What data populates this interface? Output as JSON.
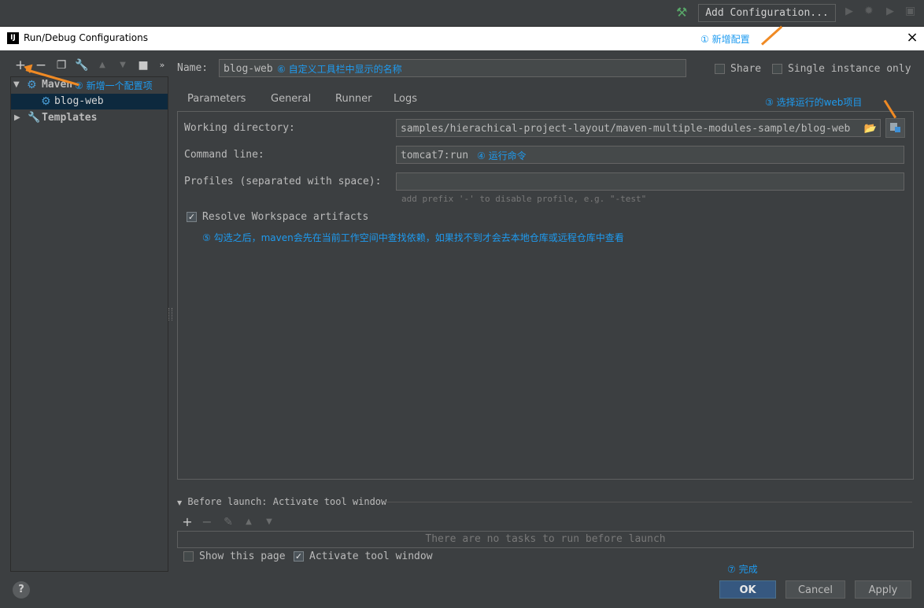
{
  "ide_toolbar": {
    "add_config_label": "Add Configuration..."
  },
  "dialog": {
    "title": "Run/Debug Configurations",
    "app_icon": "IJ",
    "close": "×",
    "help": "?"
  },
  "left_toolbar": {
    "icons": [
      "add-icon",
      "remove-icon",
      "copy-icon",
      "wrench-icon",
      "move-up-icon",
      "move-down-icon",
      "new-folder-icon",
      "more-icon"
    ]
  },
  "tree": {
    "maven_label": "Maven",
    "blog_web_label": "blog-web",
    "templates_label": "Templates"
  },
  "name_row": {
    "label": "Name:",
    "value": "blog-web",
    "share_label": "Share",
    "single_instance_label": "Single instance only"
  },
  "tabs": [
    "Parameters",
    "General",
    "Runner",
    "Logs"
  ],
  "params": {
    "working_dir_label": "Working directory:",
    "working_dir_value": "samples/hierachical-project-layout/maven-multiple-modules-sample/blog-web",
    "command_line_label": "Command line:",
    "command_line_value": "tomcat7:run",
    "profiles_label": "Profiles (separated with space):",
    "profiles_value": "",
    "profiles_hint": "add prefix '-' to disable profile, e.g. \"-test\"",
    "resolve_label": "Resolve Workspace artifacts",
    "resolve_checked": true
  },
  "before_launch": {
    "header": "Before launch: Activate tool window",
    "empty_text": "There are no tasks to run before launch",
    "show_page_label": "Show this page",
    "show_page_checked": false,
    "activate_label": "Activate tool window",
    "activate_checked": true
  },
  "buttons": {
    "ok": "OK",
    "cancel": "Cancel",
    "apply": "Apply"
  },
  "annotations": {
    "a1": "① 新增配置",
    "a2": "② 新增一个配置项",
    "a3": "③ 选择运行的web项目",
    "a4": "④ 运行命令",
    "a5": "⑤ 勾选之后，maven会先在当前工作空间中查找依赖，如果找不到才会去本地仓库或远程仓库中查看",
    "a6": "⑥ 自定义工具栏中显示的名称",
    "a7": "⑦ 完成"
  },
  "colors": {
    "annotation": "#1e9bf0",
    "arrow": "#f08a24",
    "background": "#3c3f41",
    "selection": "#0d293e",
    "ok_button": "#365880"
  }
}
